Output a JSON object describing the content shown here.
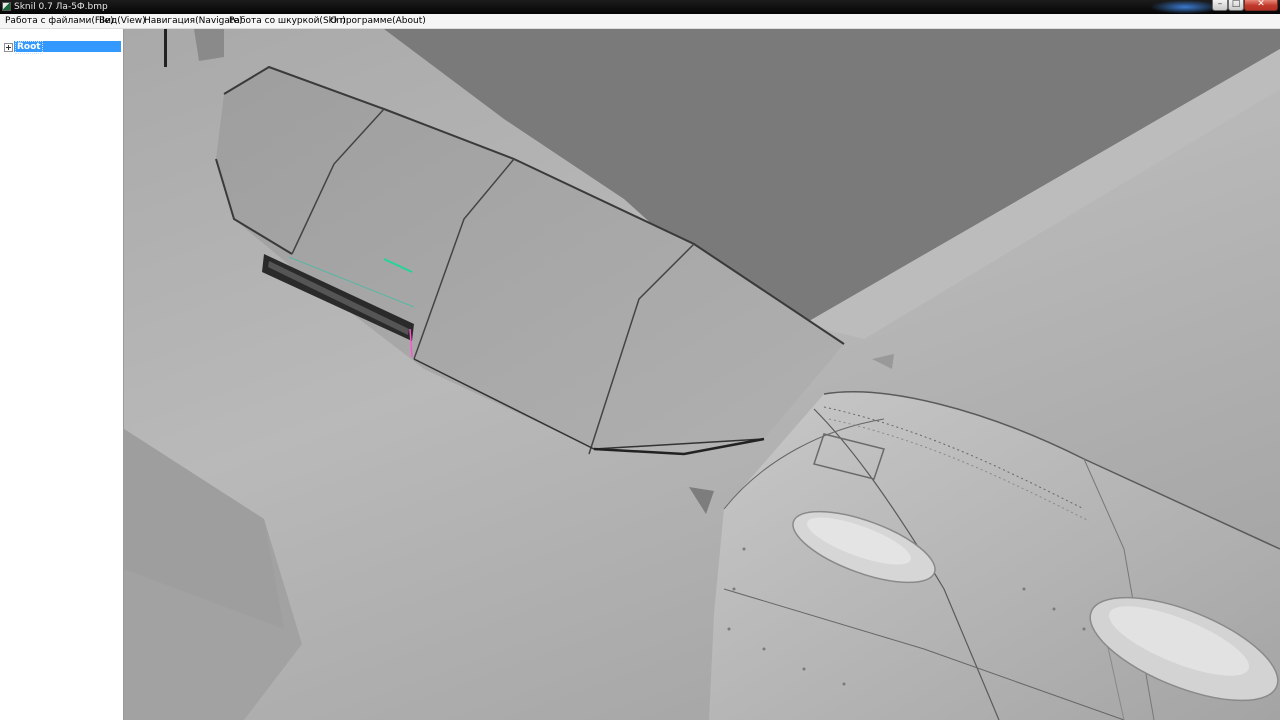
{
  "window": {
    "title": "Sknil 0.7   Ла-5Ф.bmp",
    "app_icon": "app-icon",
    "controls": {
      "minimize": "–",
      "maximize": "□",
      "close": "✕"
    }
  },
  "menu": {
    "items": [
      "Работа с файлами(File)",
      "Вид(View)",
      "Навигация(Navigate)",
      "Работа со шкуркой(Skin)",
      "О программе(About)"
    ]
  },
  "tree": {
    "root_label": "Root",
    "expanded": false
  },
  "viewport": {
    "scene": "3d-aircraft-model",
    "background_color": "#7a7a7a",
    "wing_color": "#c4c4c4",
    "fuselage_color": "#b7b7b7"
  }
}
